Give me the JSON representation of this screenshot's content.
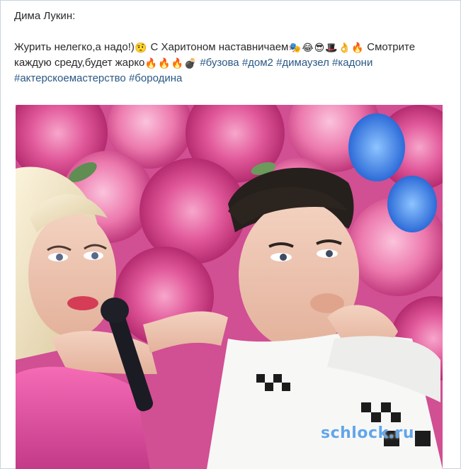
{
  "post": {
    "author": "Дима Лукин:",
    "text_line1_a": "Журить нелегко,а надо!)",
    "text_line1_b": "С Харитоном наставничаем",
    "text_line1_c": "Смотрите",
    "text_line2": "каждую среду,будет жарко",
    "hashtags": [
      "#бузова",
      "#дом2",
      "#димаузел",
      "#кадони",
      "#актерскоемастерство",
      "#бородина"
    ],
    "emojis": {
      "thinking": "🤨",
      "after_naставничаем": [
        "🎭",
        "😂",
        "😎",
        "🎩",
        "👌",
        "🔥"
      ],
      "after_zharko": [
        "🔥",
        "🔥",
        "🔥",
        "💣"
      ]
    }
  },
  "photo": {
    "watermark": "schlock.ru"
  }
}
